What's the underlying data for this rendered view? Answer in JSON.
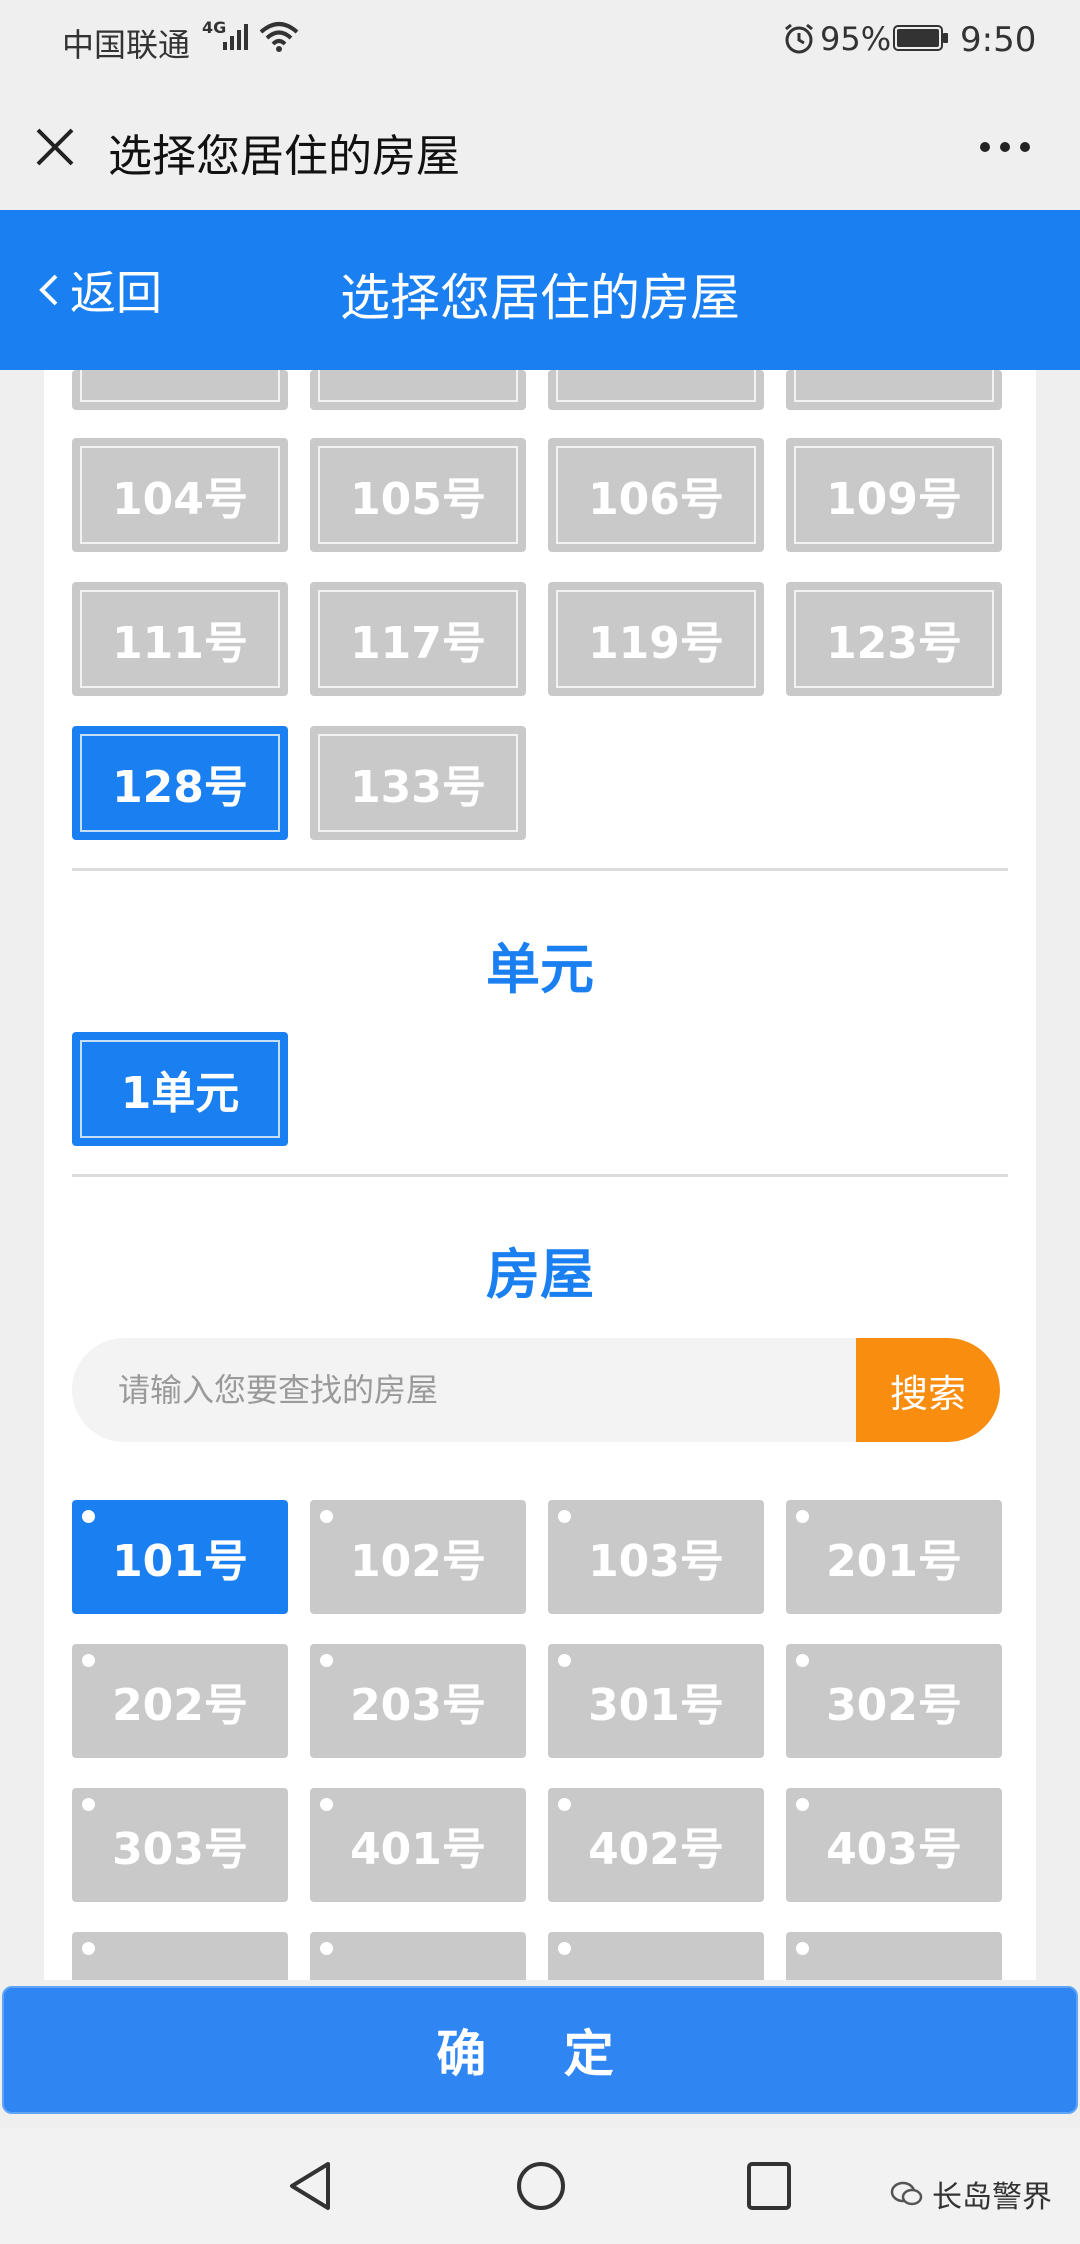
{
  "status_bar": {
    "carrier": "中国联通",
    "network": "4G",
    "battery": "95%",
    "time": "9:50",
    "icons": [
      "signal-icon",
      "wifi-icon",
      "alarm-icon",
      "battery-icon"
    ]
  },
  "nav_bar": {
    "title": "选择您居住的房屋",
    "icons": [
      "close-icon",
      "more-icon"
    ]
  },
  "header": {
    "back_label": "返回",
    "title": "选择您居住的房屋"
  },
  "buildings": {
    "items": [
      "104号",
      "105号",
      "106号",
      "109号",
      "111号",
      "117号",
      "119号",
      "123号",
      "128号",
      "133号"
    ],
    "selected": "128号"
  },
  "units": {
    "title": "单元",
    "items": [
      "1单元"
    ],
    "selected": "1单元"
  },
  "rooms": {
    "title": "房屋",
    "search": {
      "placeholder": "请输入您要查找的房屋",
      "button": "搜索"
    },
    "items": [
      "101号",
      "102号",
      "103号",
      "201号",
      "202号",
      "203号",
      "301号",
      "302号",
      "303号",
      "401号",
      "402号",
      "403号"
    ],
    "selected": "101号"
  },
  "confirm_label": "确 定",
  "watermark": "长岛警界",
  "colors": {
    "accent": "#1a7ff0",
    "search_button": "#f98d10",
    "tile_unselected": "#c9c9c9"
  }
}
